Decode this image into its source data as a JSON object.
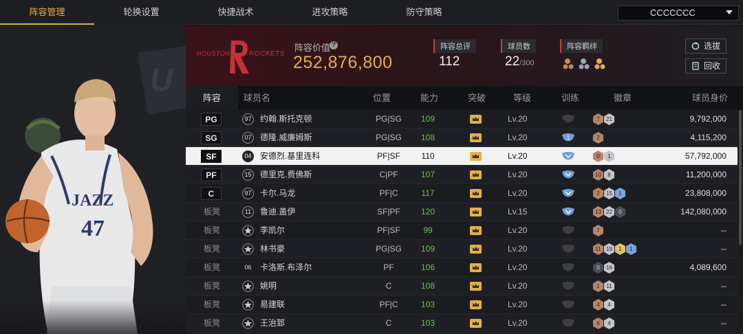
{
  "tabs": [
    "阵容管理",
    "轮换设置",
    "快捷战术",
    "进攻策略",
    "防守策略"
  ],
  "active_tab": "阵容管理",
  "team_selector": {
    "value": "CCCCCCC"
  },
  "player_image": {
    "jersey_text": "JAZZ",
    "jersey_number": "47",
    "wall_text": "U"
  },
  "team": {
    "logo_city": "HOUSTON",
    "logo_name": "ROCKETS",
    "value_label": "阵容价值",
    "value": "252,876,800",
    "stats": [
      {
        "label": "阵容总评",
        "value": "112",
        "suffix": ""
      },
      {
        "label": "球员数",
        "value": "22",
        "suffix": "/300"
      },
      {
        "label": "阵容羁绊",
        "value": "",
        "suffix": ""
      }
    ],
    "buttons": {
      "pick": "选拔",
      "recycle": "回收"
    }
  },
  "table": {
    "headers": {
      "lineup": "阵容",
      "name": "球员名",
      "position": "位置",
      "ability": "能力",
      "breakthrough": "突破",
      "level": "等级",
      "training": "训练",
      "badges": "徽章",
      "value": "球员身价"
    },
    "rows": [
      {
        "slot": "PG",
        "bench": false,
        "num": "97",
        "num_style": "circle",
        "name": "约翰.斯托克顿",
        "pos": "PG|SG",
        "ability": "109",
        "level": "Lv.20",
        "train": "gray",
        "badges": [
          [
            "7",
            "bronze"
          ],
          [
            "21",
            "silver"
          ]
        ],
        "value": "9,792,000"
      },
      {
        "slot": "SG",
        "bench": false,
        "num": "07",
        "num_style": "circle",
        "name": "德隆.威廉姆斯",
        "pos": "PG|SG",
        "ability": "108",
        "level": "Lv.20",
        "train": "blue1",
        "badges": [
          [
            "2",
            "bronze"
          ]
        ],
        "value": "4,115,200"
      },
      {
        "slot": "SF",
        "bench": false,
        "num": "04",
        "num_style": "circle",
        "name": "安德烈.基里连科",
        "pos": "PF|SF",
        "ability": "110",
        "level": "Lv.20",
        "train": "blue",
        "badges": [
          [
            "0",
            "bronze"
          ],
          [
            "1",
            "silver"
          ]
        ],
        "value": "57,792,000",
        "selected": true
      },
      {
        "slot": "PF",
        "bench": false,
        "num": "15",
        "num_style": "circle",
        "name": "德里克.费佛斯",
        "pos": "C|PF",
        "ability": "107",
        "level": "Lv.20",
        "train": "blue",
        "badges": [
          [
            "10",
            "bronze"
          ],
          [
            "8",
            "silver"
          ]
        ],
        "value": "11,200,000"
      },
      {
        "slot": "C",
        "bench": false,
        "num": "97",
        "num_style": "circle",
        "name": "卡尔.马龙",
        "pos": "PF|C",
        "ability": "117",
        "level": "Lv.20",
        "train": "blue",
        "badges": [
          [
            "2",
            "bronze"
          ],
          [
            "15",
            "silver"
          ],
          [
            "1",
            "blue"
          ]
        ],
        "value": "23,808,000"
      },
      {
        "slot": "板凳",
        "bench": true,
        "num": "11",
        "num_style": "circle",
        "name": "鲁迪.盖伊",
        "pos": "SF|PF",
        "ability": "120",
        "level": "Lv.15",
        "train": "blue",
        "badges": [
          [
            "13",
            "bronze"
          ],
          [
            "22",
            "silver"
          ],
          [
            "0",
            "dark"
          ]
        ],
        "value": "142,080,000"
      },
      {
        "slot": "板凳",
        "bench": true,
        "num": "",
        "num_style": "star",
        "name": "李凯尔",
        "pos": "PF|SF",
        "ability": "99",
        "level": "Lv.20",
        "train": "gray",
        "badges": [
          [
            "7",
            "bronze"
          ]
        ],
        "value": "--"
      },
      {
        "slot": "板凳",
        "bench": true,
        "num": "",
        "num_style": "star",
        "name": "林书豪",
        "pos": "PG|SG",
        "ability": "109",
        "level": "Lv.20",
        "train": "gray",
        "badges": [
          [
            "11",
            "bronze"
          ],
          [
            "19",
            "silver"
          ],
          [
            "1",
            "gold"
          ],
          [
            "1",
            "blue"
          ]
        ],
        "value": "--"
      },
      {
        "slot": "板凳",
        "bench": true,
        "num": "06",
        "num_style": "plain",
        "name": "卡洛斯.布泽尔",
        "pos": "PF",
        "ability": "106",
        "level": "Lv.20",
        "train": "gray",
        "badges": [
          [
            "0",
            "dark"
          ],
          [
            "16",
            "silver"
          ]
        ],
        "value": "4,089,600"
      },
      {
        "slot": "板凳",
        "bench": true,
        "num": "",
        "num_style": "star",
        "name": "姚明",
        "pos": "C",
        "ability": "108",
        "level": "Lv.20",
        "train": "gray",
        "badges": [
          [
            "1",
            "bronze"
          ],
          [
            "11",
            "silver"
          ]
        ],
        "value": "--"
      },
      {
        "slot": "板凳",
        "bench": true,
        "num": "",
        "num_style": "star",
        "name": "易建联",
        "pos": "PF|C",
        "ability": "103",
        "level": "Lv.20",
        "train": "gray",
        "badges": [
          [
            "4",
            "bronze"
          ],
          [
            "4",
            "silver"
          ]
        ],
        "value": "--"
      },
      {
        "slot": "板凳",
        "bench": true,
        "num": "",
        "num_style": "star",
        "name": "王治郅",
        "pos": "C",
        "ability": "103",
        "level": "Lv.20",
        "train": "gray",
        "badges": [
          [
            "6",
            "bronze"
          ],
          [
            "4",
            "silver"
          ]
        ],
        "value": "--"
      }
    ]
  },
  "colors": {
    "accent_gold": "#e2b04a",
    "ability_green": "#6cc04a",
    "rockets_red": "#c7303b",
    "train_blue": "#6f9fd6"
  }
}
